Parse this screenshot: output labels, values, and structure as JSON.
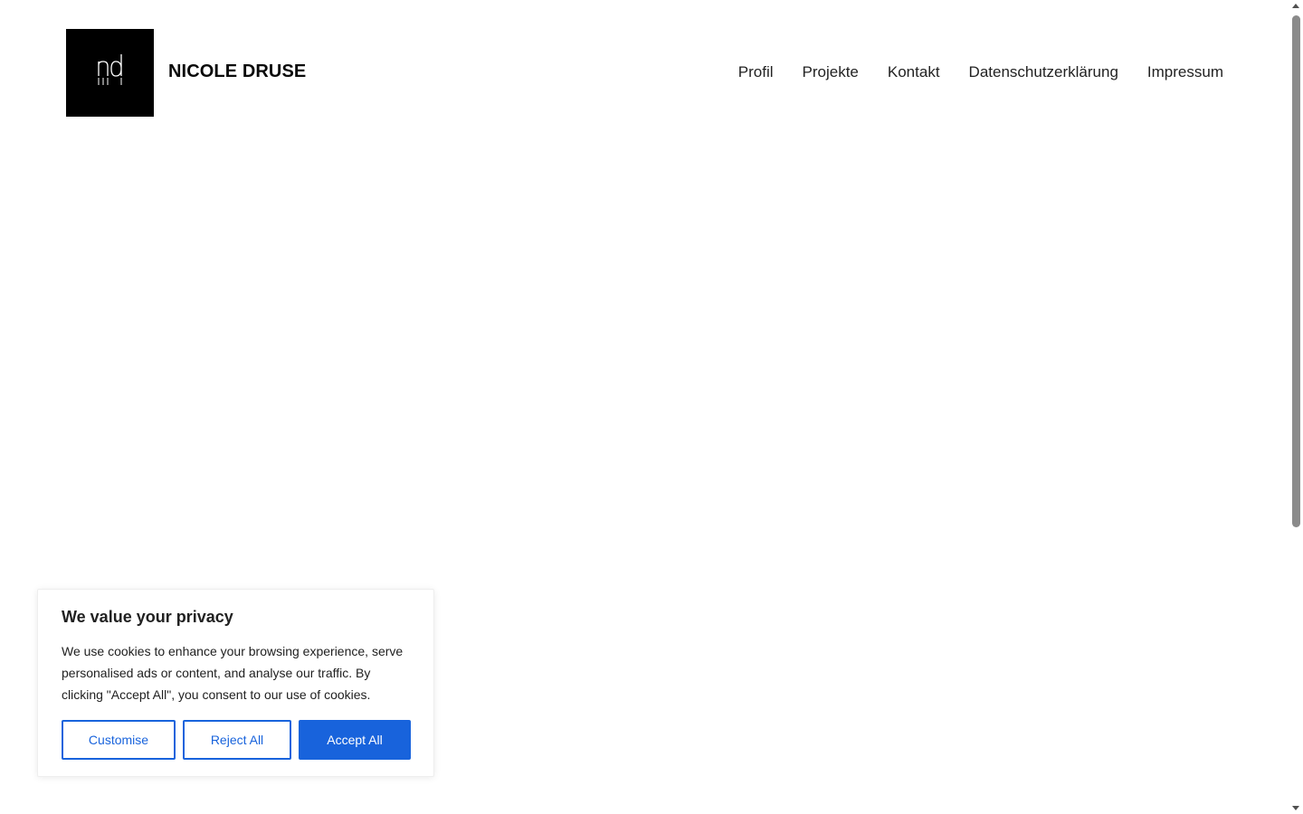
{
  "header": {
    "logo_text": "nd",
    "site_title": "NICOLE DRUSE",
    "nav": [
      {
        "label": "Profil"
      },
      {
        "label": "Projekte"
      },
      {
        "label": "Kontakt"
      },
      {
        "label": "Datenschutzerklärung"
      },
      {
        "label": "Impressum"
      }
    ]
  },
  "cookie_banner": {
    "title": "We value your privacy",
    "text": "We use cookies to enhance your browsing experience, serve personalised ads or content, and analyse our traffic. By clicking \"Accept All\", you consent to our use of cookies.",
    "customise_label": "Customise",
    "reject_label": "Reject All",
    "accept_label": "Accept All"
  },
  "colors": {
    "accent": "#1863dc",
    "logo_bg": "#000000",
    "background": "#ffffff"
  }
}
